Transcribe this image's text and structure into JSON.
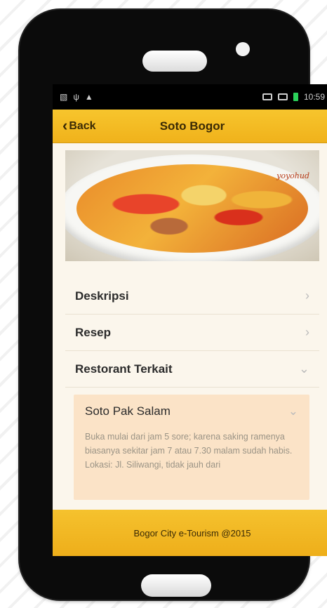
{
  "statusbar": {
    "left_icons": [
      "sim-icon",
      "usb-icon",
      "warning-icon"
    ],
    "time": "10:59"
  },
  "navbar": {
    "back_label": "Back",
    "title": "Soto Bogor"
  },
  "hero": {
    "watermark": "yoyohud"
  },
  "menu": {
    "items": [
      {
        "label": "Deskripsi",
        "icon": "chevron-right-icon"
      },
      {
        "label": "Resep",
        "icon": "chevron-right-icon"
      },
      {
        "label": "Restorant Terkait",
        "icon": "chevron-down-icon"
      }
    ]
  },
  "restaurant": {
    "name": "Soto Pak Salam",
    "description": "Buka mulai dari jam 5 sore; karena saking ramenya biasanya sekitar jam 7 atau 7.30 malam sudah habis. Lokasi: Jl. Siliwangi, tidak jauh dari"
  },
  "footer": {
    "text": "Bogor City e-Tourism @2015"
  },
  "colors": {
    "nav_bg": "#f7c52d",
    "content_bg": "#fbf6ec",
    "sub_card_bg": "#fbe3c7"
  }
}
